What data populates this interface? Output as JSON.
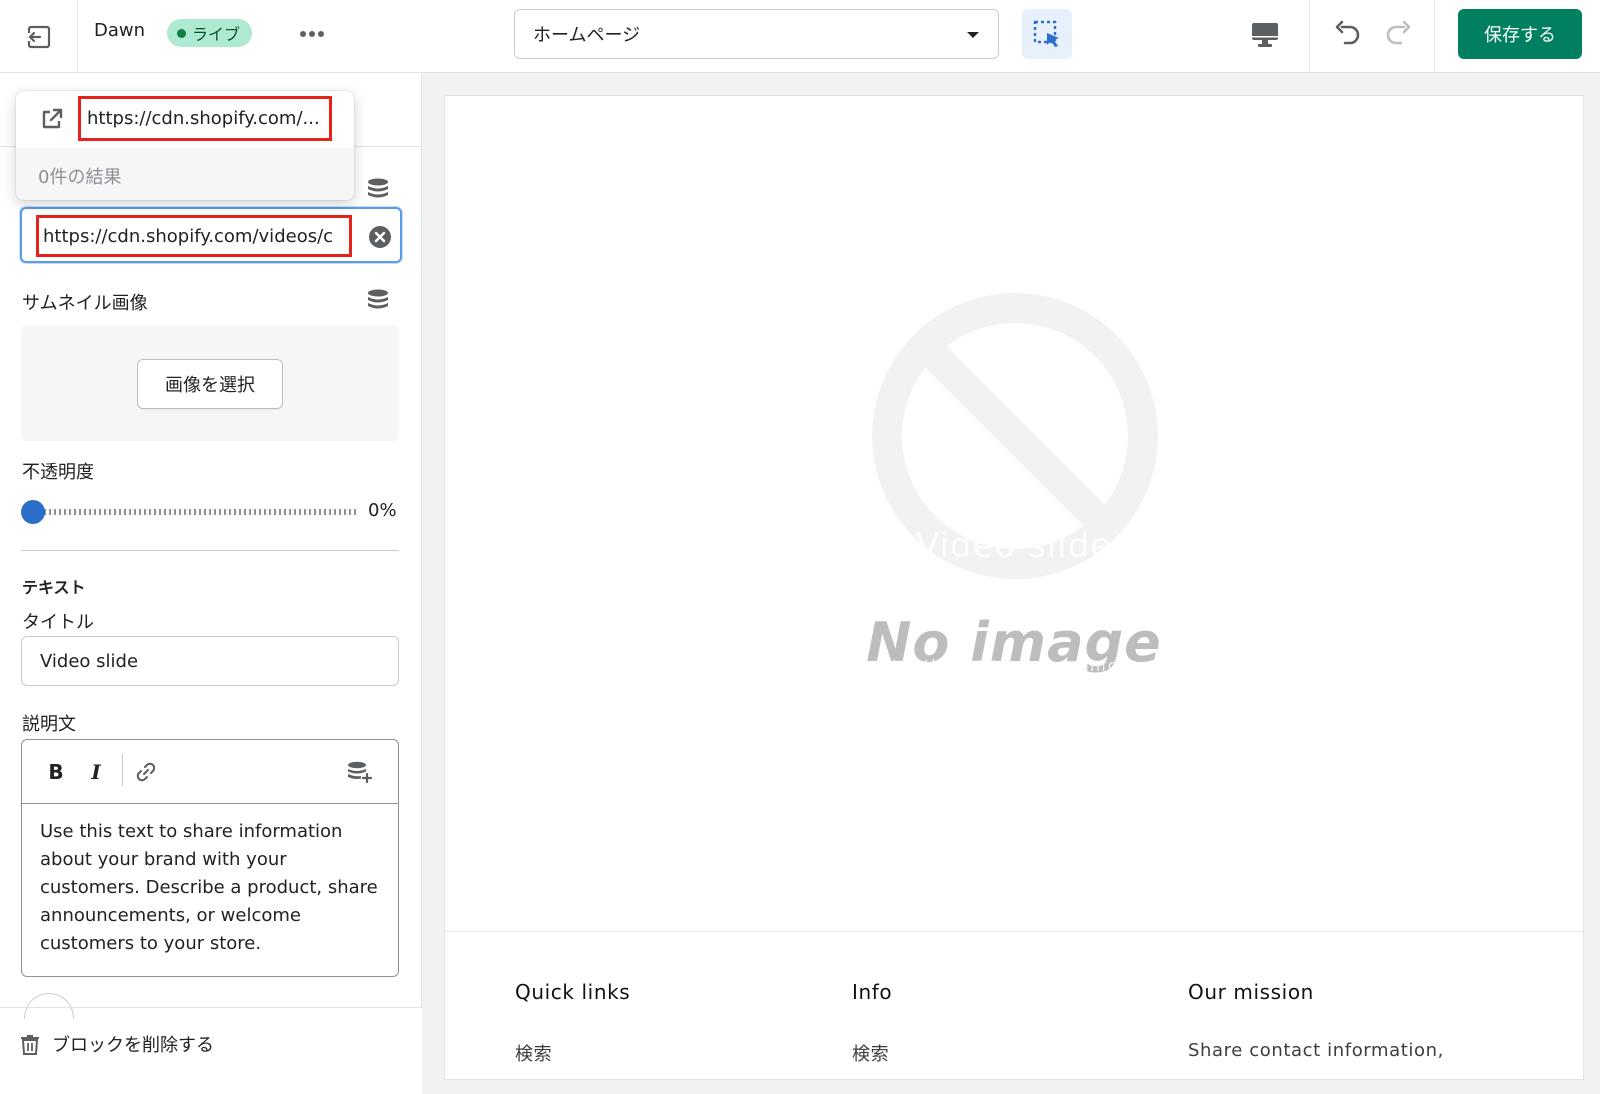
{
  "topbar": {
    "theme_name": "Dawn",
    "live_badge": "ライブ",
    "page_select_value": "ホームページ",
    "save_label": "保存する"
  },
  "popover": {
    "url_value": "https://cdn.shopify.com/...",
    "results": "0件の結果"
  },
  "sidebar": {
    "video_url_value": "https://cdn.shopify.com/videos/c",
    "thumbnail_label": "サムネイル画像",
    "select_image_label": "画像を選択",
    "opacity_label": "不透明度",
    "opacity_value": "0%",
    "opacity_fraction": 0,
    "text_section_heading": "テキスト",
    "title_label": "タイトル",
    "title_value": "Video slide",
    "description_label": "説明文",
    "rte_bold": "B",
    "rte_italic": "I",
    "description_value": "Use this text to share information about your brand with your customers. Describe a product, share announcements, or welcome customers to your store.",
    "delete_block_label": "ブロックを削除する"
  },
  "preview": {
    "slide_title": "Video slide",
    "no_image_text": "No image",
    "slide_description": "Use this text to share information about your brand with your customers. Describe a product, share announcements, or welcome customers to your store.",
    "footer": [
      {
        "heading": "Quick links",
        "link": "検索"
      },
      {
        "heading": "Info",
        "link": "検索"
      },
      {
        "heading": "Our mission",
        "link": "Share contact information,"
      }
    ]
  },
  "colors": {
    "accent": "#008060",
    "live_badge_bg": "#aee9d1",
    "focus_blue": "#2c6ecb",
    "highlight_red": "#e5231b"
  }
}
